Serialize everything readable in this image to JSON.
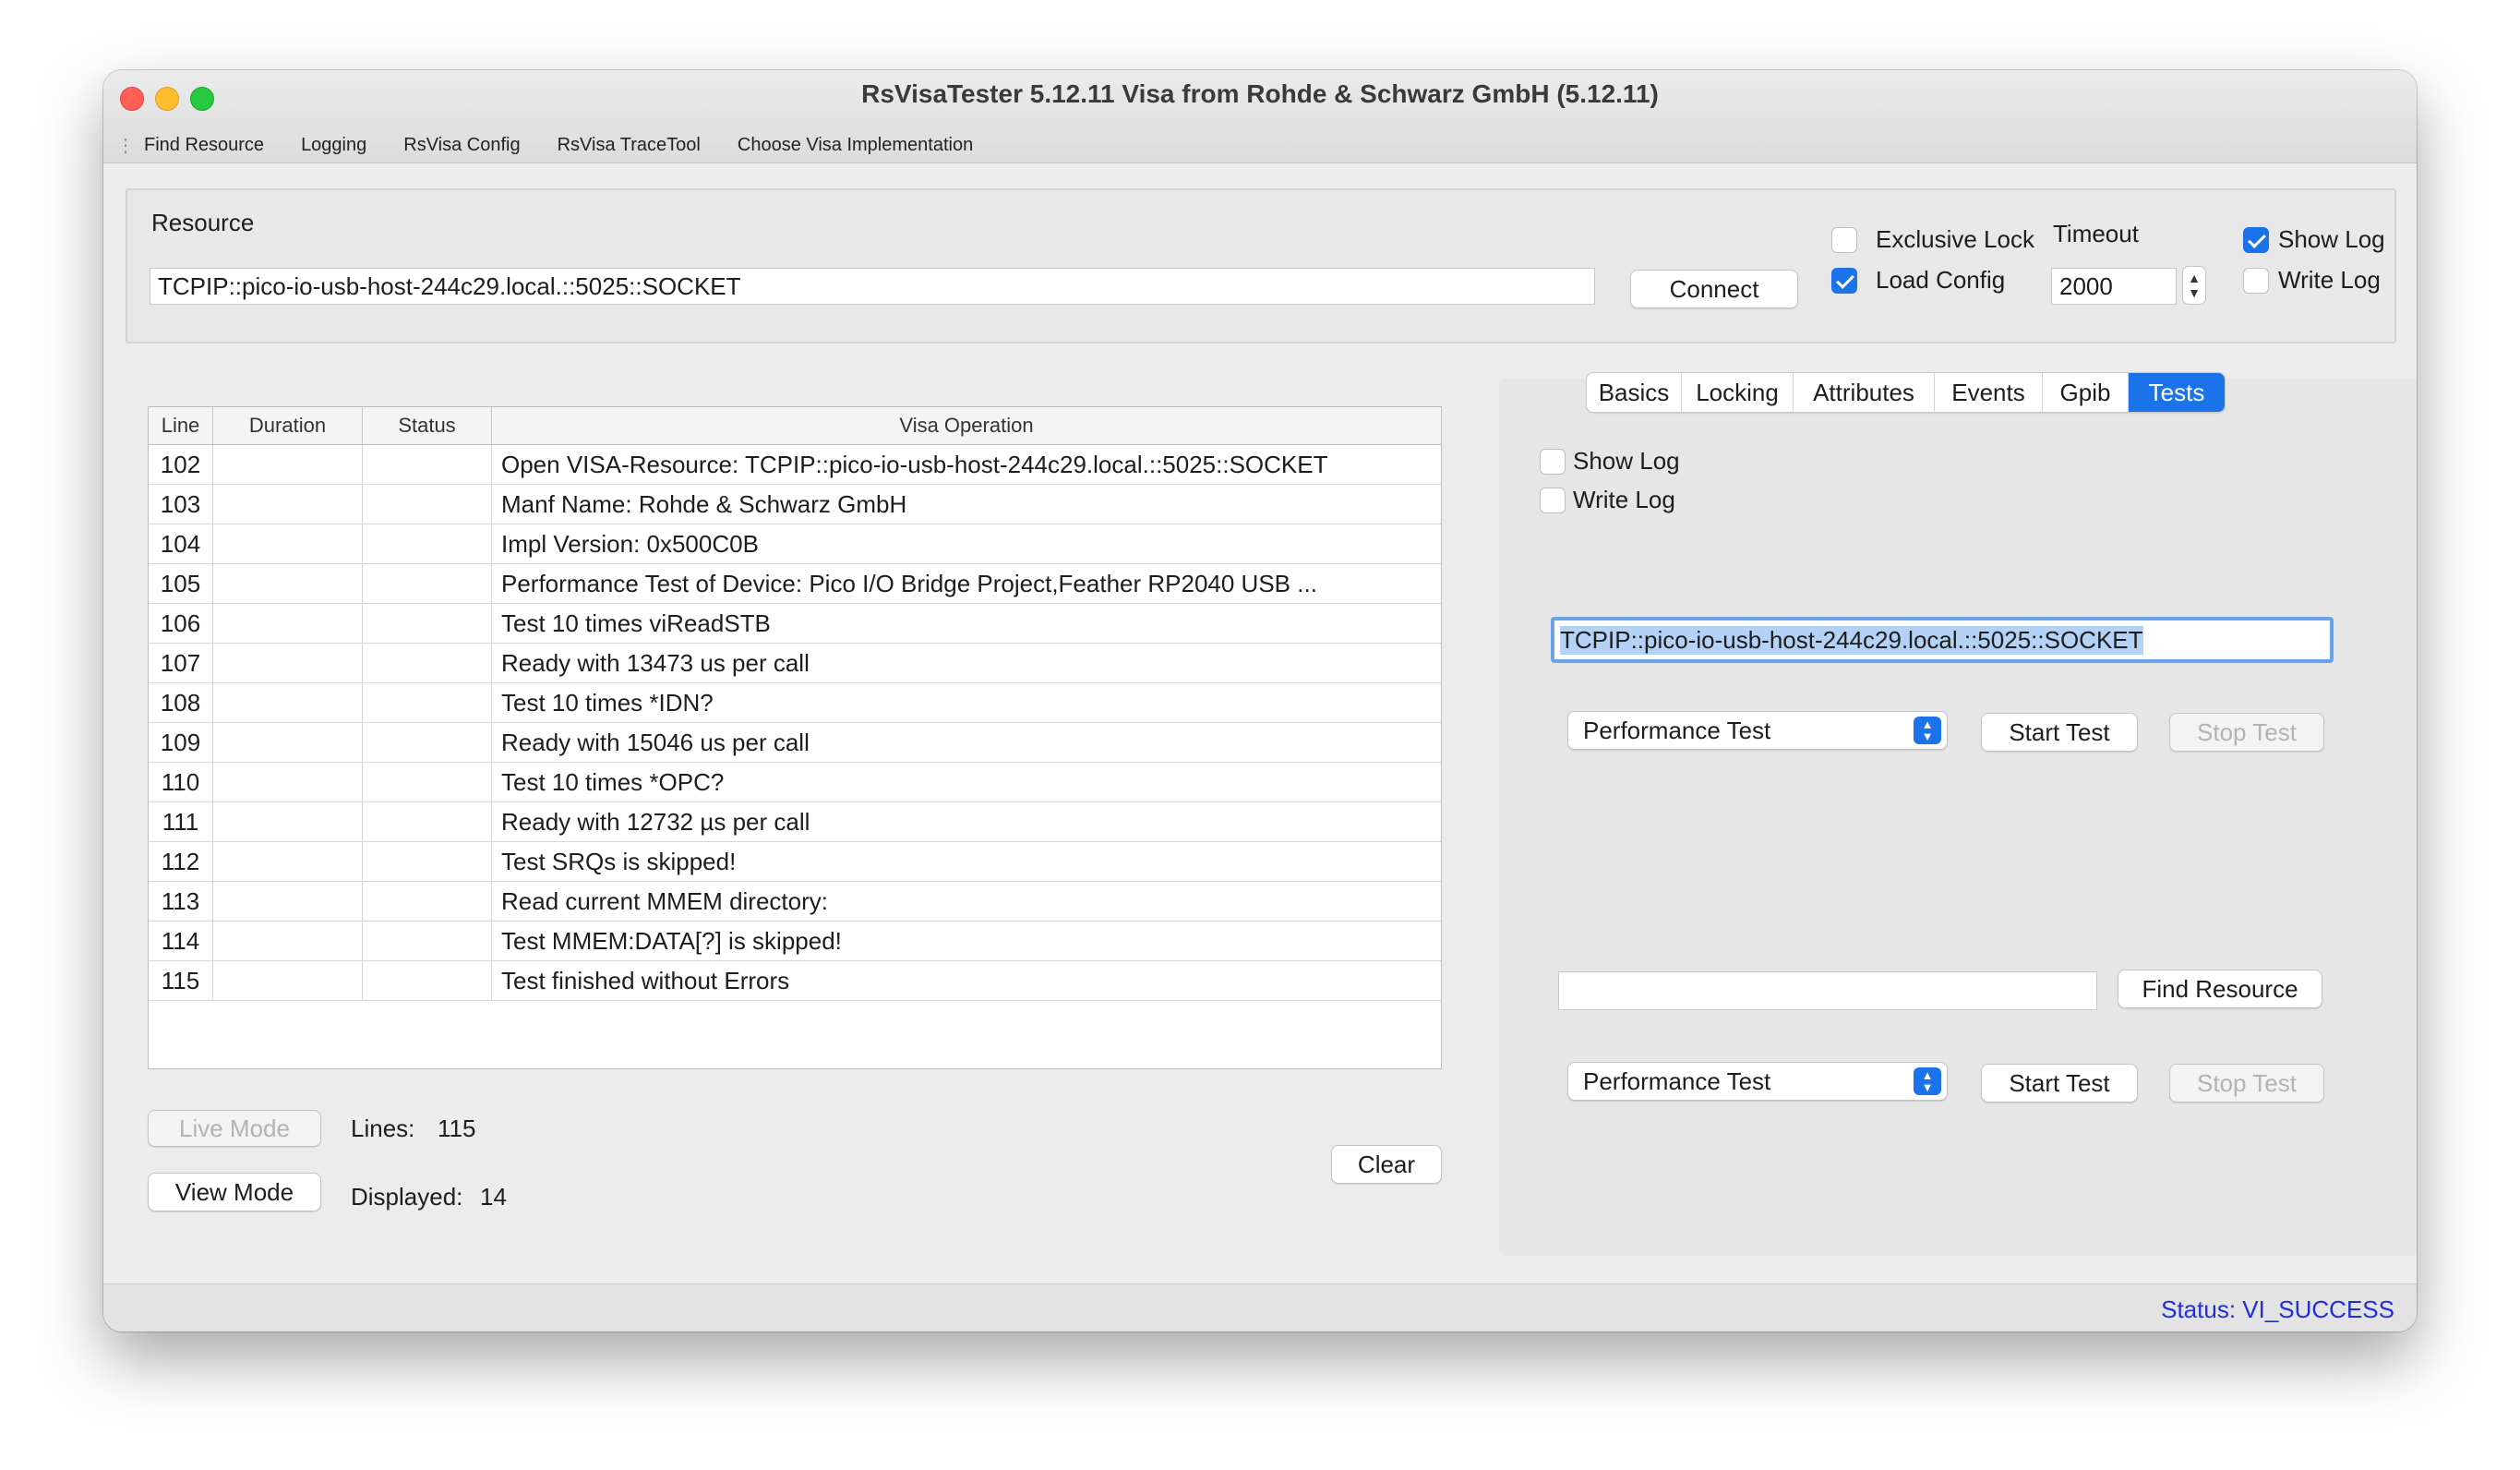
{
  "window": {
    "title": "RsVisaTester 5.12.11 Visa from Rohde & Schwarz GmbH (5.12.11)"
  },
  "menu": {
    "items": [
      "Find Resource",
      "Logging",
      "RsVisa Config",
      "RsVisa TraceTool",
      "Choose Visa Implementation"
    ]
  },
  "resource_group": {
    "label": "Resource",
    "value": "TCPIP::pico-io-usb-host-244c29.local.::5025::SOCKET",
    "connect_label": "Connect",
    "exclusive_lock_label": "Exclusive Lock",
    "exclusive_lock_checked": false,
    "load_config_label": "Load Config",
    "load_config_checked": true,
    "timeout_label": "Timeout",
    "timeout_value": "2000",
    "show_log_label": "Show Log",
    "show_log_checked": true,
    "write_log_label": "Write Log",
    "write_log_checked": false
  },
  "log_table": {
    "columns": [
      "Line",
      "Duration",
      "Status",
      "Visa Operation"
    ],
    "rows": [
      {
        "line": "102",
        "duration": "",
        "status": "",
        "op": "Open VISA-Resource: TCPIP::pico-io-usb-host-244c29.local.::5025::SOCKET"
      },
      {
        "line": "103",
        "duration": "",
        "status": "",
        "op": "Manf Name: Rohde & Schwarz GmbH"
      },
      {
        "line": "104",
        "duration": "",
        "status": "",
        "op": "Impl Version: 0x500C0B"
      },
      {
        "line": "105",
        "duration": "",
        "status": "",
        "op": "Performance Test of Device: Pico I/O Bridge Project,Feather RP2040 USB ..."
      },
      {
        "line": "106",
        "duration": "",
        "status": "",
        "op": "Test 10 times viReadSTB"
      },
      {
        "line": "107",
        "duration": "",
        "status": "",
        "op": "Ready with 13473 us per call"
      },
      {
        "line": "108",
        "duration": "",
        "status": "",
        "op": "Test 10 times *IDN?"
      },
      {
        "line": "109",
        "duration": "",
        "status": "",
        "op": "Ready with 15046 us per call"
      },
      {
        "line": "110",
        "duration": "",
        "status": "",
        "op": "Test 10 times *OPC?"
      },
      {
        "line": "111",
        "duration": "",
        "status": "",
        "op": "Ready with 12732 µs per call"
      },
      {
        "line": "112",
        "duration": "",
        "status": "",
        "op": "Test SRQs is skipped!"
      },
      {
        "line": "113",
        "duration": "",
        "status": "",
        "op": "Read current MMEM directory:"
      },
      {
        "line": "114",
        "duration": "",
        "status": "",
        "op": "Test MMEM:DATA[?] is skipped!"
      },
      {
        "line": "115",
        "duration": "",
        "status": "",
        "op": "Test finished without Errors"
      }
    ]
  },
  "log_controls": {
    "live_mode_label": "Live Mode",
    "view_mode_label": "View Mode",
    "lines_label": "Lines:",
    "lines_value": "115",
    "displayed_label": "Displayed:",
    "displayed_value": "14",
    "clear_label": "Clear"
  },
  "tabs": {
    "items": [
      "Basics",
      "Locking",
      "Attributes",
      "Events",
      "Gpib",
      "Tests"
    ],
    "active": "Tests"
  },
  "tests_tab": {
    "show_log_label": "Show Log",
    "show_log_checked": false,
    "write_log_label": "Write Log",
    "write_log_checked": false,
    "resource_value": "TCPIP::pico-io-usb-host-244c29.local.::5025::SOCKET",
    "test_select_1": "Performance Test",
    "start_test_1": "Start Test",
    "stop_test_1": "Stop Test",
    "find_value": "",
    "find_resource_label": "Find Resource",
    "test_select_2": "Performance Test",
    "start_test_2": "Start Test",
    "stop_test_2": "Stop Test"
  },
  "status": {
    "text": "Status: VI_SUCCESS",
    "color": "#1f2fd6"
  },
  "colors": {
    "accent": "#1a73e8"
  }
}
